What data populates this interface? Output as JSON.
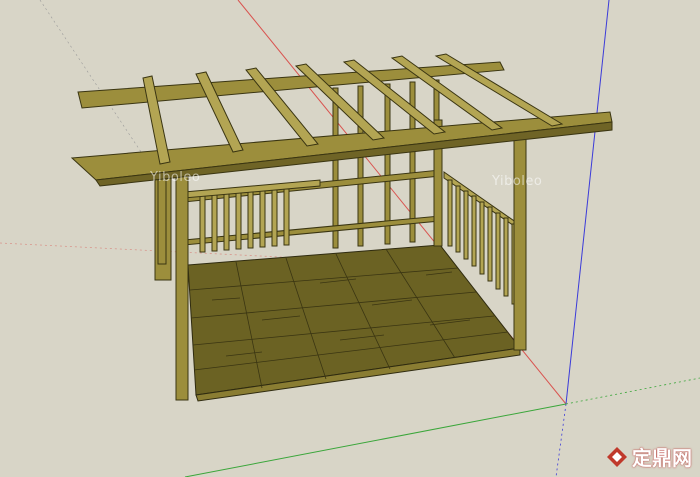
{
  "watermark": {
    "text": "Yiboleo",
    "brand_text": "定鼎网"
  },
  "colors": {
    "background": "#d8d5c7",
    "wood": "#9c8e3c",
    "wood_dark": "#5d5520",
    "wood_light": "#b3a553",
    "floor": "#6b6223",
    "axis_red": "#d9534f",
    "axis_green": "#3aa63a",
    "axis_blue": "#3b3bd9",
    "brand_red": "#c0392b"
  },
  "icons": {
    "brand_logo": "red-diamond-logo-icon"
  }
}
